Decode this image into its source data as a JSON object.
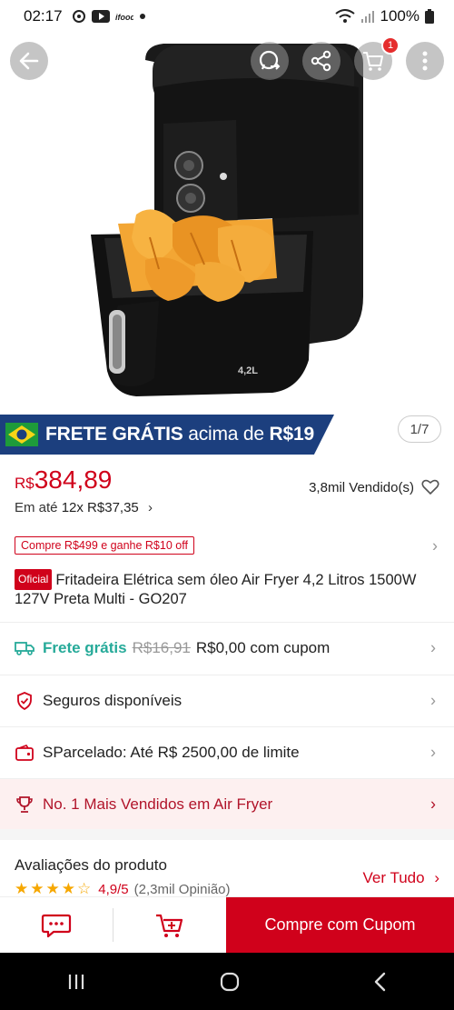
{
  "status_bar": {
    "time": "02:17",
    "battery": "100%",
    "notification_icons": [
      "alarm-sync-icon",
      "youtube-icon",
      "ifood-icon",
      "dot-icon"
    ]
  },
  "hero": {
    "buttons": [
      "back-icon",
      "whatsapp-share-icon",
      "share-icon",
      "cart-icon",
      "more-icon"
    ],
    "cart_badge": "1",
    "image_alt": "Air fryer with fries",
    "image_counter": "1/7",
    "capacity_label": "4,2L"
  },
  "promo_banner": {
    "strong": "FRETE GRÁTIS",
    "middle": "acima de",
    "amount": "R$19"
  },
  "price": {
    "currency": "R$",
    "value": "384,89",
    "installments_prefix": "Em até",
    "installments": "12x R$37,35",
    "sold": "3,8mil Vendido(s)"
  },
  "coupon": {
    "label": "Compre R$499 e ganhe R$10 off"
  },
  "product": {
    "badge": "Oficial",
    "title": "Fritadeira Elétrica sem óleo Air Fryer 4,2 Litros 1500W 127V Preta Multi - GO207"
  },
  "rows": {
    "shipping_label": "Frete grátis",
    "shipping_old": "R$16,91",
    "shipping_new": "R$0,00 com cupom",
    "insurance": "Seguros disponíveis",
    "installment_credit": "SParcelado: Até R$ 2500,00 de limite",
    "top_seller": "No. 1 Mais Vendidos em Air Fryer"
  },
  "reviews": {
    "heading": "Avaliações do produto",
    "rating": 4.9,
    "score": "4,9/5",
    "count": "(2,3mil Opinião)",
    "see_all": "Ver Tudo"
  },
  "bottom_bar": {
    "buy_label": "Compre com Cupom"
  },
  "colors": {
    "brand_red": "#d0011b",
    "teal": "#26aa99",
    "banner_blue": "#1c3f7e",
    "star": "#f6a700"
  }
}
